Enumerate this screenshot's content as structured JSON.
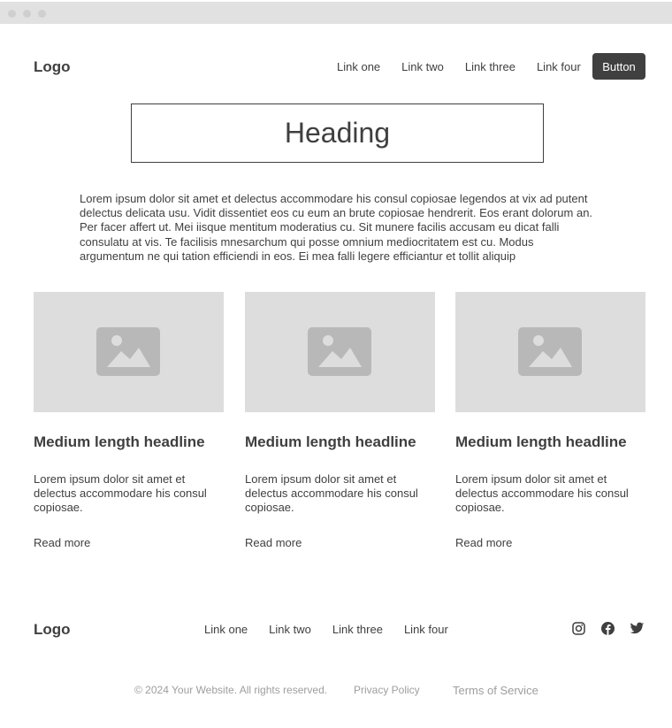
{
  "header": {
    "logo": "Logo",
    "nav": [
      "Link one",
      "Link two",
      "Link three",
      "Link four"
    ],
    "button_label": "Button"
  },
  "hero": {
    "heading": "Heading",
    "body": "Lorem ipsum dolor sit amet et delectus accommodare his consul copiosae legendos at vix ad putent delectus delicata usu. Vidit dissentiet eos cu eum an brute copiosae hendrerit. Eos erant dolorum an. Per facer affert ut. Mei iisque mentitum moderatius cu. Sit munere facilis accusam eu dicat falli consulatu at vis. Te facilisis mnesarchum qui posse omnium mediocritatem est cu. Modus argumentum ne qui tation efficiendi in eos. Ei mea falli legere efficiantur et tollit aliquip"
  },
  "cards": [
    {
      "icon": "image-placeholder-icon",
      "headline": "Medium length headline",
      "text": "Lorem ipsum dolor sit amet et delectus accommodare his consul copiosae.",
      "link": "Read more"
    },
    {
      "icon": "image-placeholder-icon",
      "headline": "Medium length headline",
      "text": "Lorem ipsum dolor sit amet et delectus accommodare his consul copiosae.",
      "link": "Read more"
    },
    {
      "icon": "image-placeholder-icon",
      "headline": "Medium length headline",
      "text": "Lorem ipsum dolor sit amet et delectus accommodare his consul copiosae.",
      "link": "Read more"
    }
  ],
  "footer": {
    "logo": "Logo",
    "nav": [
      "Link one",
      "Link two",
      "Link three",
      "Link four"
    ],
    "social": [
      "instagram-icon",
      "facebook-icon",
      "twitter-icon"
    ],
    "copyright": "© 2024 Your Website. All rights reserved.",
    "privacy": "Privacy Policy",
    "terms": "Terms of Service"
  },
  "colors": {
    "text": "#3f3f3f",
    "button_bg": "#404040",
    "placeholder_bg": "#dddddd",
    "placeholder_icon": "#b8b8b8",
    "muted": "#9e9e9e",
    "titlebar": "#e1e1e1"
  }
}
